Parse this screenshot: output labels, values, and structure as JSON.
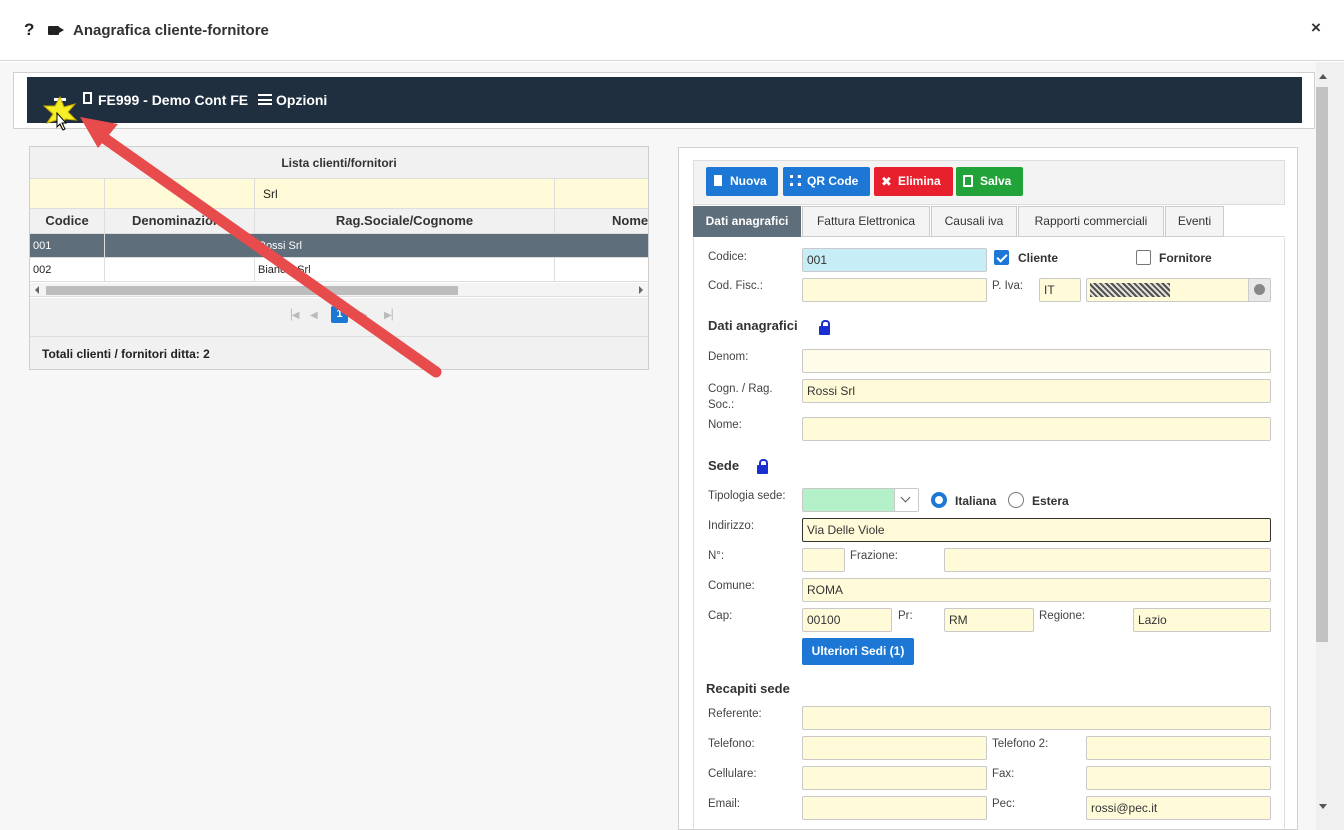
{
  "window": {
    "help": "?",
    "title": "Anagrafica cliente-fornitore",
    "close": "×"
  },
  "header": {
    "company": "FE999 - Demo Cont FE",
    "options": "Opzioni"
  },
  "list": {
    "title": "Lista clienti/fornitori",
    "filter_values": [
      "",
      "",
      "Srl",
      ""
    ],
    "columns": [
      "Codice",
      "Denominazione",
      "Rag.Sociale/Cognome",
      "Nome"
    ],
    "rows": [
      {
        "code": "001",
        "denom": "",
        "rag": "Rossi Srl",
        "name": ""
      },
      {
        "code": "002",
        "denom": "",
        "rag": "Bianchi Srl",
        "name": ""
      }
    ],
    "page": "1",
    "footer": "Totali clienti / fornitori ditta: 2"
  },
  "toolbar": {
    "new": "Nuova",
    "qr": "QR Code",
    "delete": "Elimina",
    "save": "Salva"
  },
  "tabs": [
    "Dati anagrafici",
    "Fattura Elettronica",
    "Causali iva",
    "Rapporti commerciali",
    "Eventi"
  ],
  "form": {
    "code_label": "Codice:",
    "code_value": "001",
    "client_label": "Cliente",
    "supplier_label": "Fornitore",
    "fiscal_label": "Cod. Fisc.:",
    "vat_label": "P. Iva:",
    "vat_country": "IT",
    "section_personal": "Dati anagrafici",
    "denom_label": "Denom:",
    "surname_label": "Cogn. / Rag. Soc.:",
    "surname_value": "Rossi Srl",
    "name_label": "Nome:",
    "section_site": "Sede",
    "site_type_label": "Tipologia sede:",
    "italian_label": "Italiana",
    "foreign_label": "Estera",
    "address_label": "Indirizzo:",
    "address_value": "Via Delle Viole",
    "number_label": "N°:",
    "fraction_label": "Frazione:",
    "city_label": "Comune:",
    "city_value": "ROMA",
    "cap_label": "Cap:",
    "cap_value": "00100",
    "prov_label": "Pr:",
    "prov_value": "RM",
    "region_label": "Regione:",
    "region_value": "Lazio",
    "more_sites": "Ulteriori Sedi (1)",
    "section_contacts": "Recapiti sede",
    "referent_label": "Referente:",
    "phone_label": "Telefono:",
    "phone2_label": "Telefono 2:",
    "mobile_label": "Cellulare:",
    "fax_label": "Fax:",
    "email_label": "Email:",
    "pec_label": "Pec:",
    "pec_value": "rossi@pec.it"
  },
  "colors": {
    "dark_bar": "#1f2f3f",
    "accent": "#1c78d4",
    "danger": "#e8202d",
    "success": "#22a33a",
    "field": "#fffbd9",
    "code_field": "#c7eef7",
    "annotation_arrow": "#e84b4b"
  }
}
